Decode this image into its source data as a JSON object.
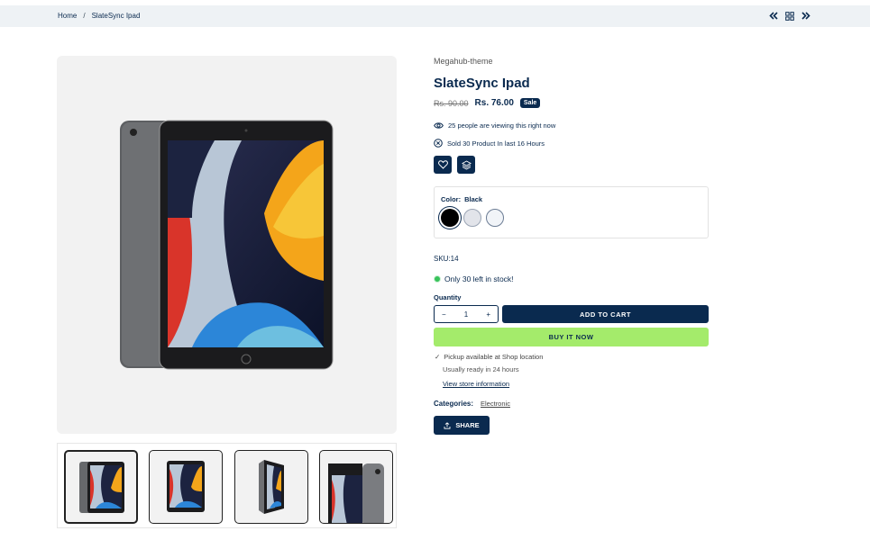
{
  "breadcrumb": {
    "home": "Home",
    "separator": "/",
    "current": "SlateSync Ipad"
  },
  "nav_icons": [
    "chevrons-left-icon",
    "grid-icon",
    "chevrons-right-icon"
  ],
  "product": {
    "vendor": "Megahub-theme",
    "title": "SlateSync Ipad",
    "compare_price": "Rs. 90.00",
    "price": "Rs. 76.00",
    "badge": "Sale",
    "viewing_count": "25",
    "viewing_text": "people are viewing this right now",
    "sold_prefix": "Sold",
    "sold_count": "30",
    "sold_middle": "Product In last",
    "sold_hours": "16",
    "sold_suffix": "Hours",
    "sku": "SKU:14",
    "stock_text": "Only 30 left in stock!",
    "images": [
      "ipad-front-back",
      "ipad-front",
      "ipad-side-angle",
      "ipad-side-closeup"
    ]
  },
  "actions": {
    "wishlist_icon": "heart-icon",
    "compare_icon": "layers-icon"
  },
  "color": {
    "label": "Color:",
    "selected": "Black",
    "options": [
      {
        "name": "Black",
        "hex": "#000000"
      },
      {
        "name": "Silver",
        "hex": "#e2e4ea"
      },
      {
        "name": "White",
        "hex": "#f1f4f8"
      }
    ]
  },
  "quantity": {
    "label": "Quantity",
    "value": "1",
    "minus": "−",
    "plus": "+"
  },
  "buttons": {
    "add_to_cart": "ADD TO CART",
    "buy_now": "BUY IT NOW",
    "share": "SHARE"
  },
  "pickup": {
    "check": "✓",
    "available": "Pickup available at Shop location",
    "ready": "Usually ready in 24 hours",
    "link": "View store information"
  },
  "categories": {
    "label": "Categories:",
    "value": "Electronic"
  },
  "colors": {
    "brand": "#0a2a4f",
    "buy": "#a4eb6b",
    "topbar": "#eef2f5"
  }
}
